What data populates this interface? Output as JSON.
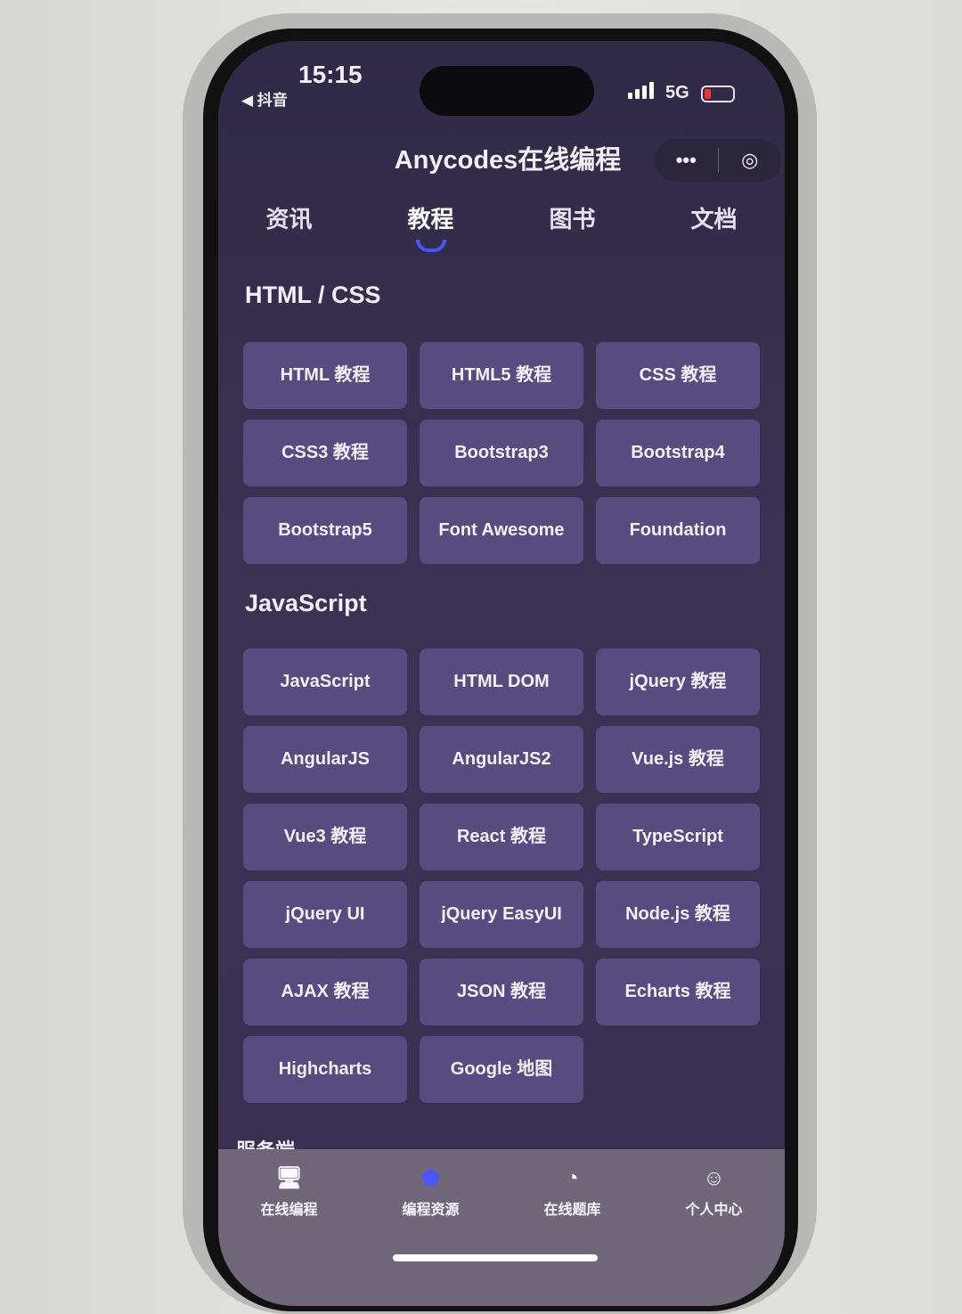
{
  "status": {
    "time": "15:15",
    "back_app": "◀ 抖音",
    "network": "5G",
    "battery_color": "#e33333"
  },
  "header": {
    "title": "Anycodes在线编程",
    "more_icon": "•••",
    "target_icon": "◎"
  },
  "tabs": [
    {
      "label": "资讯"
    },
    {
      "label": "教程",
      "active": true
    },
    {
      "label": "图书"
    },
    {
      "label": "文档"
    }
  ],
  "accent": "#4a55ff",
  "sections": [
    {
      "title": "HTML / CSS",
      "items": [
        "HTML 教程",
        "HTML5 教程",
        "CSS 教程",
        "CSS3 教程",
        "Bootstrap3",
        "Bootstrap4",
        "Bootstrap5",
        "Font Awesome",
        "Foundation"
      ]
    },
    {
      "title": "JavaScript",
      "items": [
        "JavaScript",
        "HTML DOM",
        "jQuery 教程",
        "AngularJS",
        "AngularJS2",
        "Vue.js 教程",
        "Vue3 教程",
        "React 教程",
        "TypeScript",
        "jQuery UI",
        "jQuery EasyUI",
        "Node.js 教程",
        "AJAX 教程",
        "JSON 教程",
        "Echarts 教程",
        "Highcharts",
        "Google 地图"
      ]
    },
    {
      "title": "服务端"
    }
  ],
  "bottom_nav": [
    {
      "label": "在线编程",
      "icon": "code-monitor"
    },
    {
      "label": "编程资源",
      "icon": "graduation-cap",
      "active": true
    },
    {
      "label": "在线题库",
      "icon": "pie-chart"
    },
    {
      "label": "个人中心",
      "icon": "robot-avatar"
    }
  ]
}
